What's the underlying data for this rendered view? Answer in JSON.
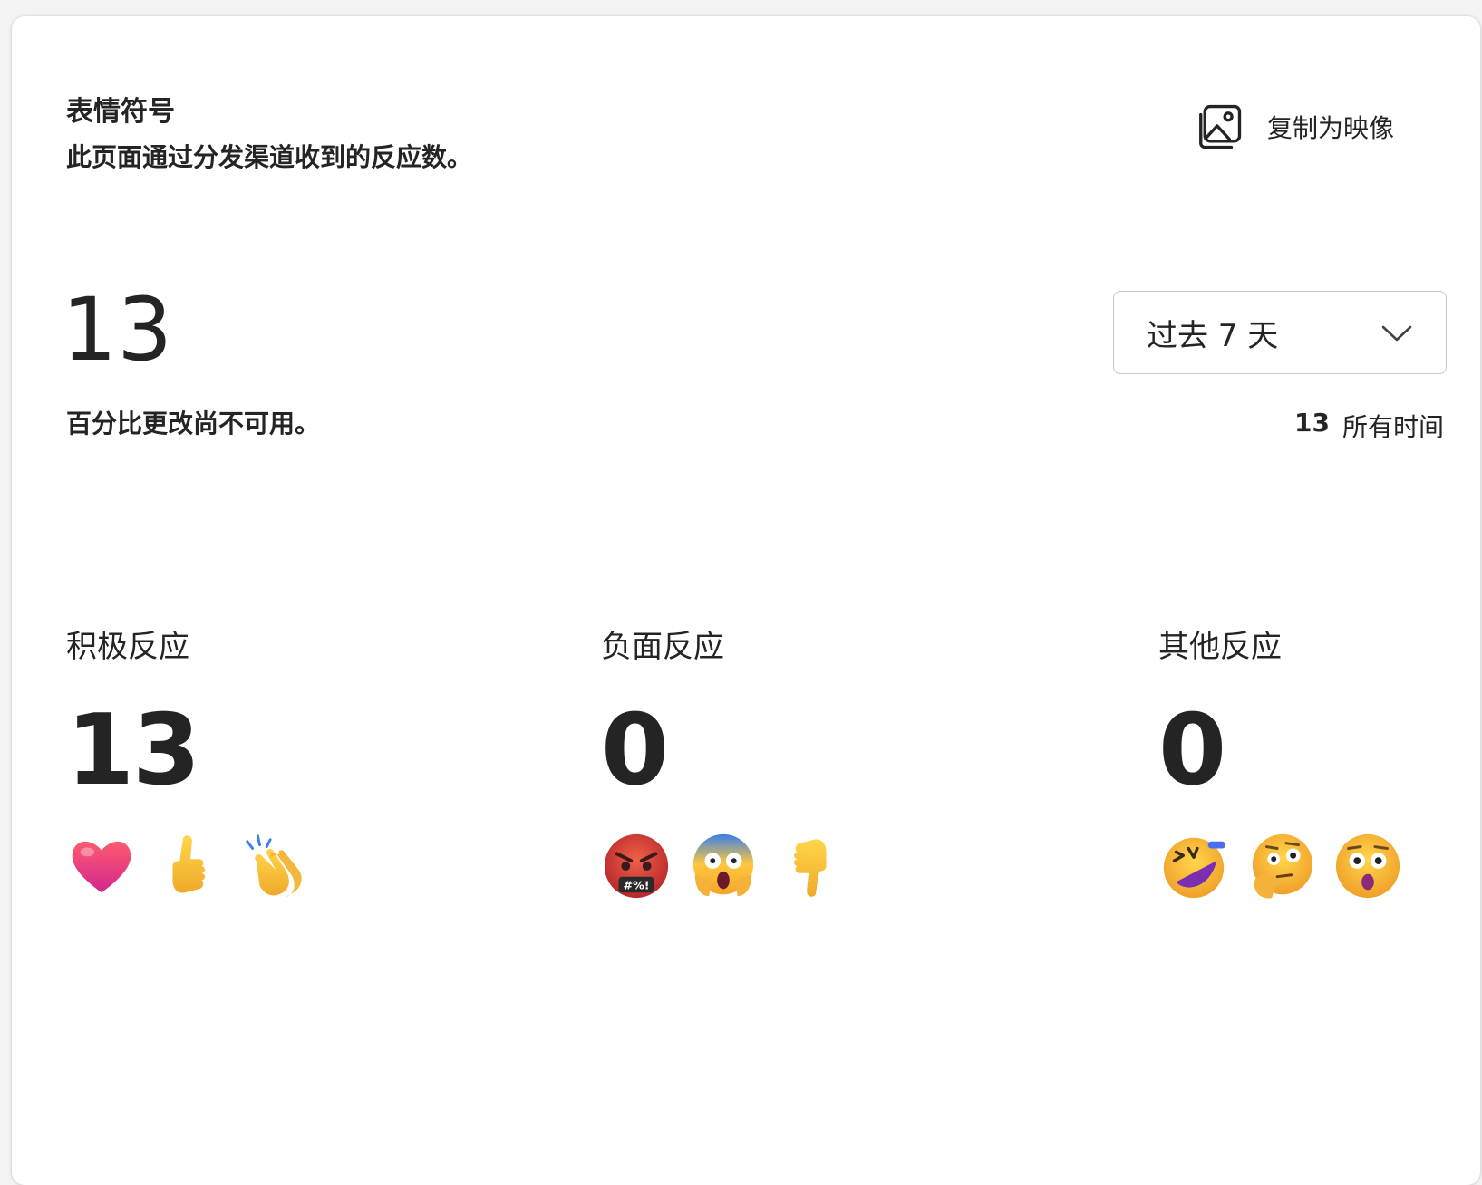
{
  "header": {
    "title": "表情符号",
    "subtitle": "此页面通过分发渠道收到的反应数。",
    "copy_button_label": "复制为映像"
  },
  "summary": {
    "total": "13",
    "note": "百分比更改尚不可用。",
    "range_selected": "过去 7 天",
    "alltime_count": "13",
    "alltime_label": "所有时间"
  },
  "groups": [
    {
      "label": "积极反应",
      "count": "13",
      "emojis": [
        "heart-icon",
        "thumbs-up-icon",
        "clapping-hands-icon"
      ]
    },
    {
      "label": "负面反应",
      "count": "0",
      "emojis": [
        "angry-face-icon",
        "screaming-face-icon",
        "thumbs-down-icon"
      ]
    },
    {
      "label": "其他反应",
      "count": "0",
      "emojis": [
        "rolling-laughing-face-icon",
        "thinking-face-icon",
        "astonished-face-icon"
      ]
    }
  ]
}
